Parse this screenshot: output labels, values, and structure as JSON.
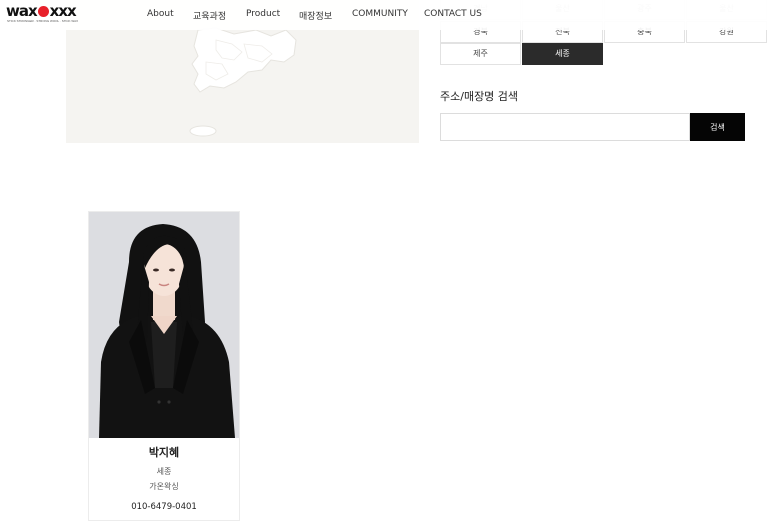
{
  "brand": {
    "logo_text_a": "wax",
    "logo_text_b": "xxx",
    "tagline": "STICK STRONGER · STRONG WOOL · STICK WAX"
  },
  "nav": {
    "items": [
      "About",
      "교육과정",
      "Product",
      "매장정보",
      "COMMUNITY",
      "CONTACT US"
    ]
  },
  "regions": {
    "row0": [
      "경남",
      "울산",
      "광주",
      "울산"
    ],
    "row1": [
      "경북",
      "전북",
      "충북",
      "강원"
    ],
    "row2": [
      "제주",
      "세종"
    ],
    "selected": "세종"
  },
  "search": {
    "title": "주소/매장명 검색",
    "placeholder": "",
    "value": "",
    "button_label": "검색"
  },
  "store_card": {
    "name": "박지혜",
    "region": "세종",
    "store": "가온왁싱",
    "phone": "010-6479-0401"
  },
  "colors": {
    "accent_red": "#e8202a",
    "button_dark": "#050505",
    "selected_cell": "#2b2b2b"
  }
}
